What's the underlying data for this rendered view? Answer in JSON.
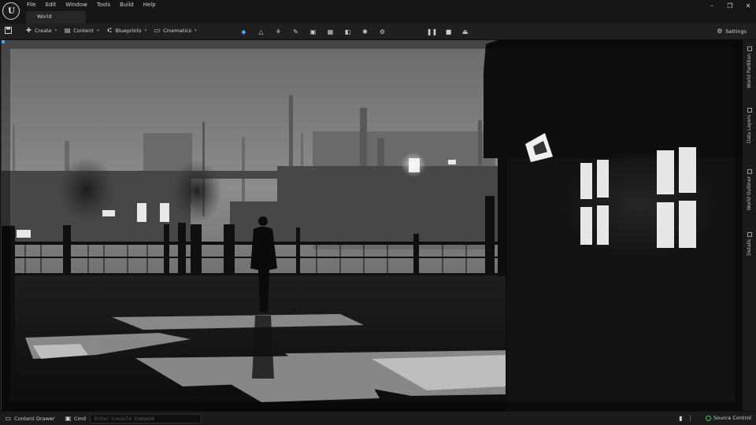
{
  "app": {
    "logo_text": "U",
    "menu": [
      "File",
      "Edit",
      "Window",
      "Tools",
      "Build",
      "Help"
    ],
    "tab_label": "World"
  },
  "toolbar": {
    "create_label": "Create",
    "content_label": "Content",
    "blueprints_label": "Blueprints",
    "cinematics_label": "Cinematics",
    "settings_label": "Settings"
  },
  "right_rail": {
    "items": [
      "World Partition",
      "Data Layers",
      "World Outliner",
      "Details"
    ]
  },
  "statusbar": {
    "content_drawer_label": "Content Drawer",
    "cmd_label": "Cmd",
    "console_placeholder": "Enter Console Command",
    "source_control_label": "Source Control"
  },
  "colors": {
    "accent": "#4aa3ff",
    "source_control_ok": "#49c255",
    "window_bg": "#151515",
    "toolbar_bg": "#1f1f1f"
  }
}
